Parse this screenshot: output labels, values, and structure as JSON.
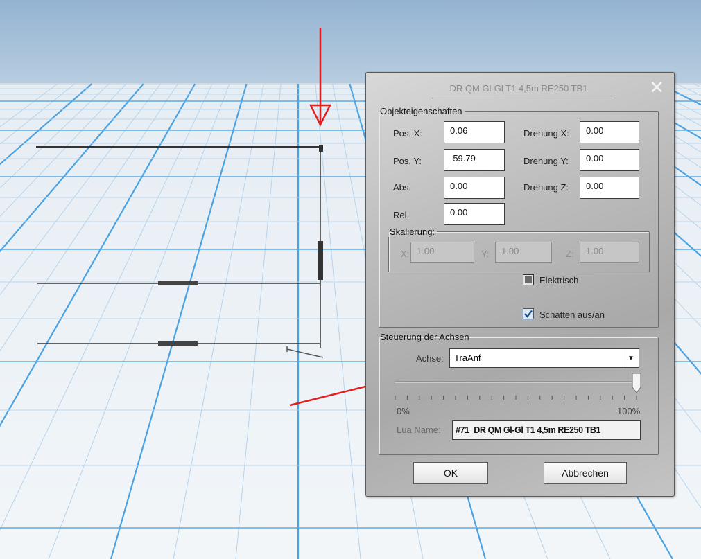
{
  "dialog": {
    "title": "DR QM Gl-Gl T1 4,5m RE250 TB1",
    "close_glyph": "✕"
  },
  "object_properties": {
    "legend": "Objekteigenschaften",
    "pos_x": {
      "label": "Pos. X:",
      "value": "0.06"
    },
    "pos_y": {
      "label": "Pos. Y:",
      "value": "-59.79"
    },
    "abs": {
      "label": "Abs.",
      "value": "0.00"
    },
    "rel": {
      "label": "Rel.",
      "value": "0.00"
    },
    "rot_x": {
      "label": "Drehung X:",
      "value": "0.00"
    },
    "rot_y": {
      "label": "Drehung Y:",
      "value": "0.00"
    },
    "rot_z": {
      "label": "Drehung Z:",
      "value": "0.00"
    },
    "scaling": {
      "legend": "Skalierung:",
      "x": {
        "label": "X:",
        "value": "1.00"
      },
      "y": {
        "label": "Y:",
        "value": "1.00"
      },
      "z": {
        "label": "Z:",
        "value": "1.00"
      }
    },
    "electric": {
      "label": "Elektrisch",
      "checked": false
    },
    "shadow": {
      "label": "Schatten aus/an",
      "checked": true
    }
  },
  "axis_control": {
    "legend": "Steuerung der Achsen",
    "axis_label": "Achse:",
    "axis_value": "TraAnf",
    "slider_value_percent": 100,
    "slider_min_label": "0%",
    "slider_max_label": "100%",
    "lua_label": "Lua Name:",
    "lua_value": "#71_DR QM Gl-Gl T1 4,5m RE250 TB1"
  },
  "buttons": {
    "ok": "OK",
    "cancel": "Abbrechen"
  },
  "colors": {
    "annotation_arrow": "#e31e1e",
    "sky": "#9fbbd6",
    "grid": "#4aa2e2",
    "dialog": "#b4b4b4"
  }
}
